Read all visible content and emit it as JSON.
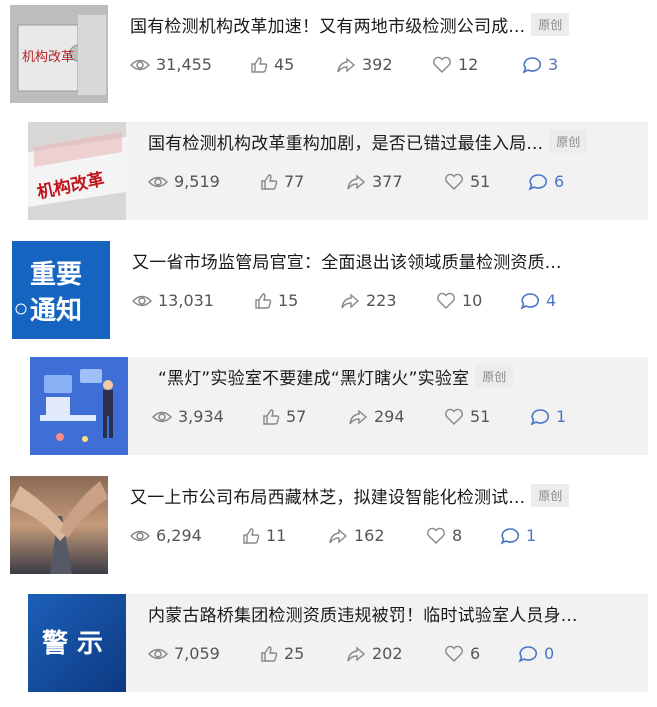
{
  "feed": {
    "items": [
      {
        "title": "国有检测机构改革加速！又有两地市级检测公司成...",
        "badge": "原创",
        "views": "31,455",
        "likes": "45",
        "shares": "392",
        "favorites": "12",
        "comments": "3",
        "thumb_text": "机构改革"
      },
      {
        "title": "国有检测机构改革重构加剧，是否已错过最佳入局...",
        "badge": "原创",
        "views": "9,519",
        "likes": "77",
        "shares": "377",
        "favorites": "51",
        "comments": "6",
        "thumb_text": "机构改革"
      },
      {
        "title": "又一省市场监管局官宣：全面退出该领域质量检测资质...",
        "badge": "",
        "views": "13,031",
        "likes": "15",
        "shares": "223",
        "favorites": "10",
        "comments": "4",
        "thumb_text_line1": "重要",
        "thumb_text_line2": "通知"
      },
      {
        "title": "“黑灯”实验室不要建成“黑灯瞎火”实验室",
        "badge": "原创",
        "views": "3,934",
        "likes": "57",
        "shares": "294",
        "favorites": "51",
        "comments": "1"
      },
      {
        "title": "又一上市公司布局西藏林芝，拟建设智能化检测试...",
        "badge": "原创",
        "views": "6,294",
        "likes": "11",
        "shares": "162",
        "favorites": "8",
        "comments": "1"
      },
      {
        "title": "内蒙古路桥集团检测资质违规被罚！临时试验室人员身...",
        "badge": "",
        "views": "7,059",
        "likes": "25",
        "shares": "202",
        "favorites": "6",
        "comments": "0",
        "thumb_text": "警 示"
      }
    ]
  }
}
